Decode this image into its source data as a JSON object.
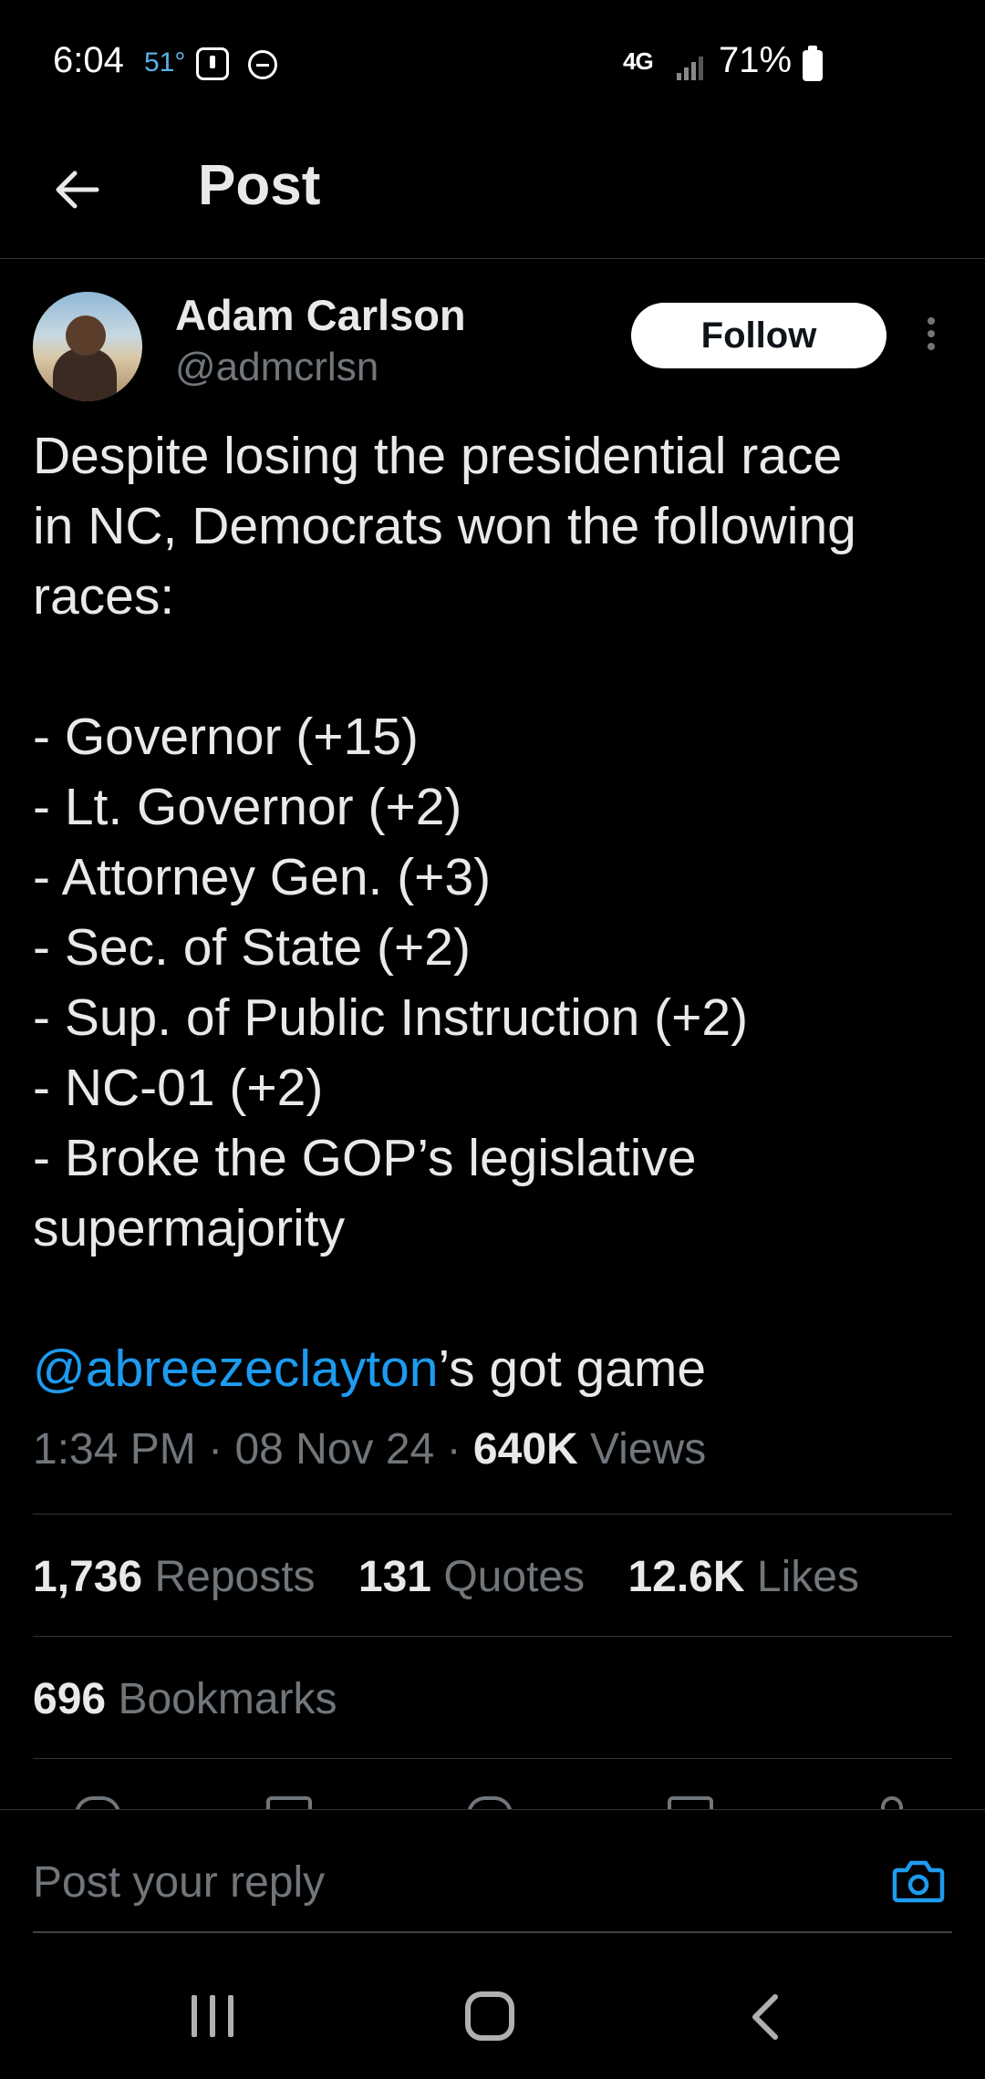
{
  "status_bar": {
    "time": "6:04",
    "temperature": "51°",
    "network": "4G",
    "battery": "71%",
    "icons": [
      "notification-icon",
      "do-not-disturb-icon",
      "signal-icon",
      "battery-icon"
    ]
  },
  "header": {
    "title": "Post",
    "back_icon": "back-arrow-icon"
  },
  "author": {
    "name": "Adam Carlson",
    "handle": "@admcrlsn",
    "follow_label": "Follow"
  },
  "tweet": {
    "lines": [
      "Despite losing the presidential race",
      "in NC, Democrats won the following",
      "races:",
      "",
      "- Governor (+15)",
      "- Lt. Governor (+2)",
      "- Attorney Gen. (+3)",
      "- Sec. of State (+2)",
      "- Sup. of Public Instruction (+2)",
      "- NC-01 (+2)",
      "- Broke the GOP’s legislative",
      "supermajority",
      ""
    ],
    "mention": "@abreezeclayton",
    "mention_suffix": "’s got game"
  },
  "meta": {
    "time": "1:34 PM",
    "date": "08 Nov 24",
    "views_count": "640K",
    "views_label": "Views",
    "separator": "·"
  },
  "stats": {
    "reposts_count": "1,736",
    "reposts_label": "Reposts",
    "quotes_count": "131",
    "quotes_label": "Quotes",
    "likes_count": "12.6K",
    "likes_label": "Likes",
    "bookmarks_count": "696",
    "bookmarks_label": "Bookmarks"
  },
  "reply": {
    "placeholder": "Post your reply"
  },
  "colors": {
    "background": "#000000",
    "text_primary": "#e7e9ea",
    "text_secondary": "#71767b",
    "accent": "#1d9bf0",
    "divider": "#2f3336"
  }
}
